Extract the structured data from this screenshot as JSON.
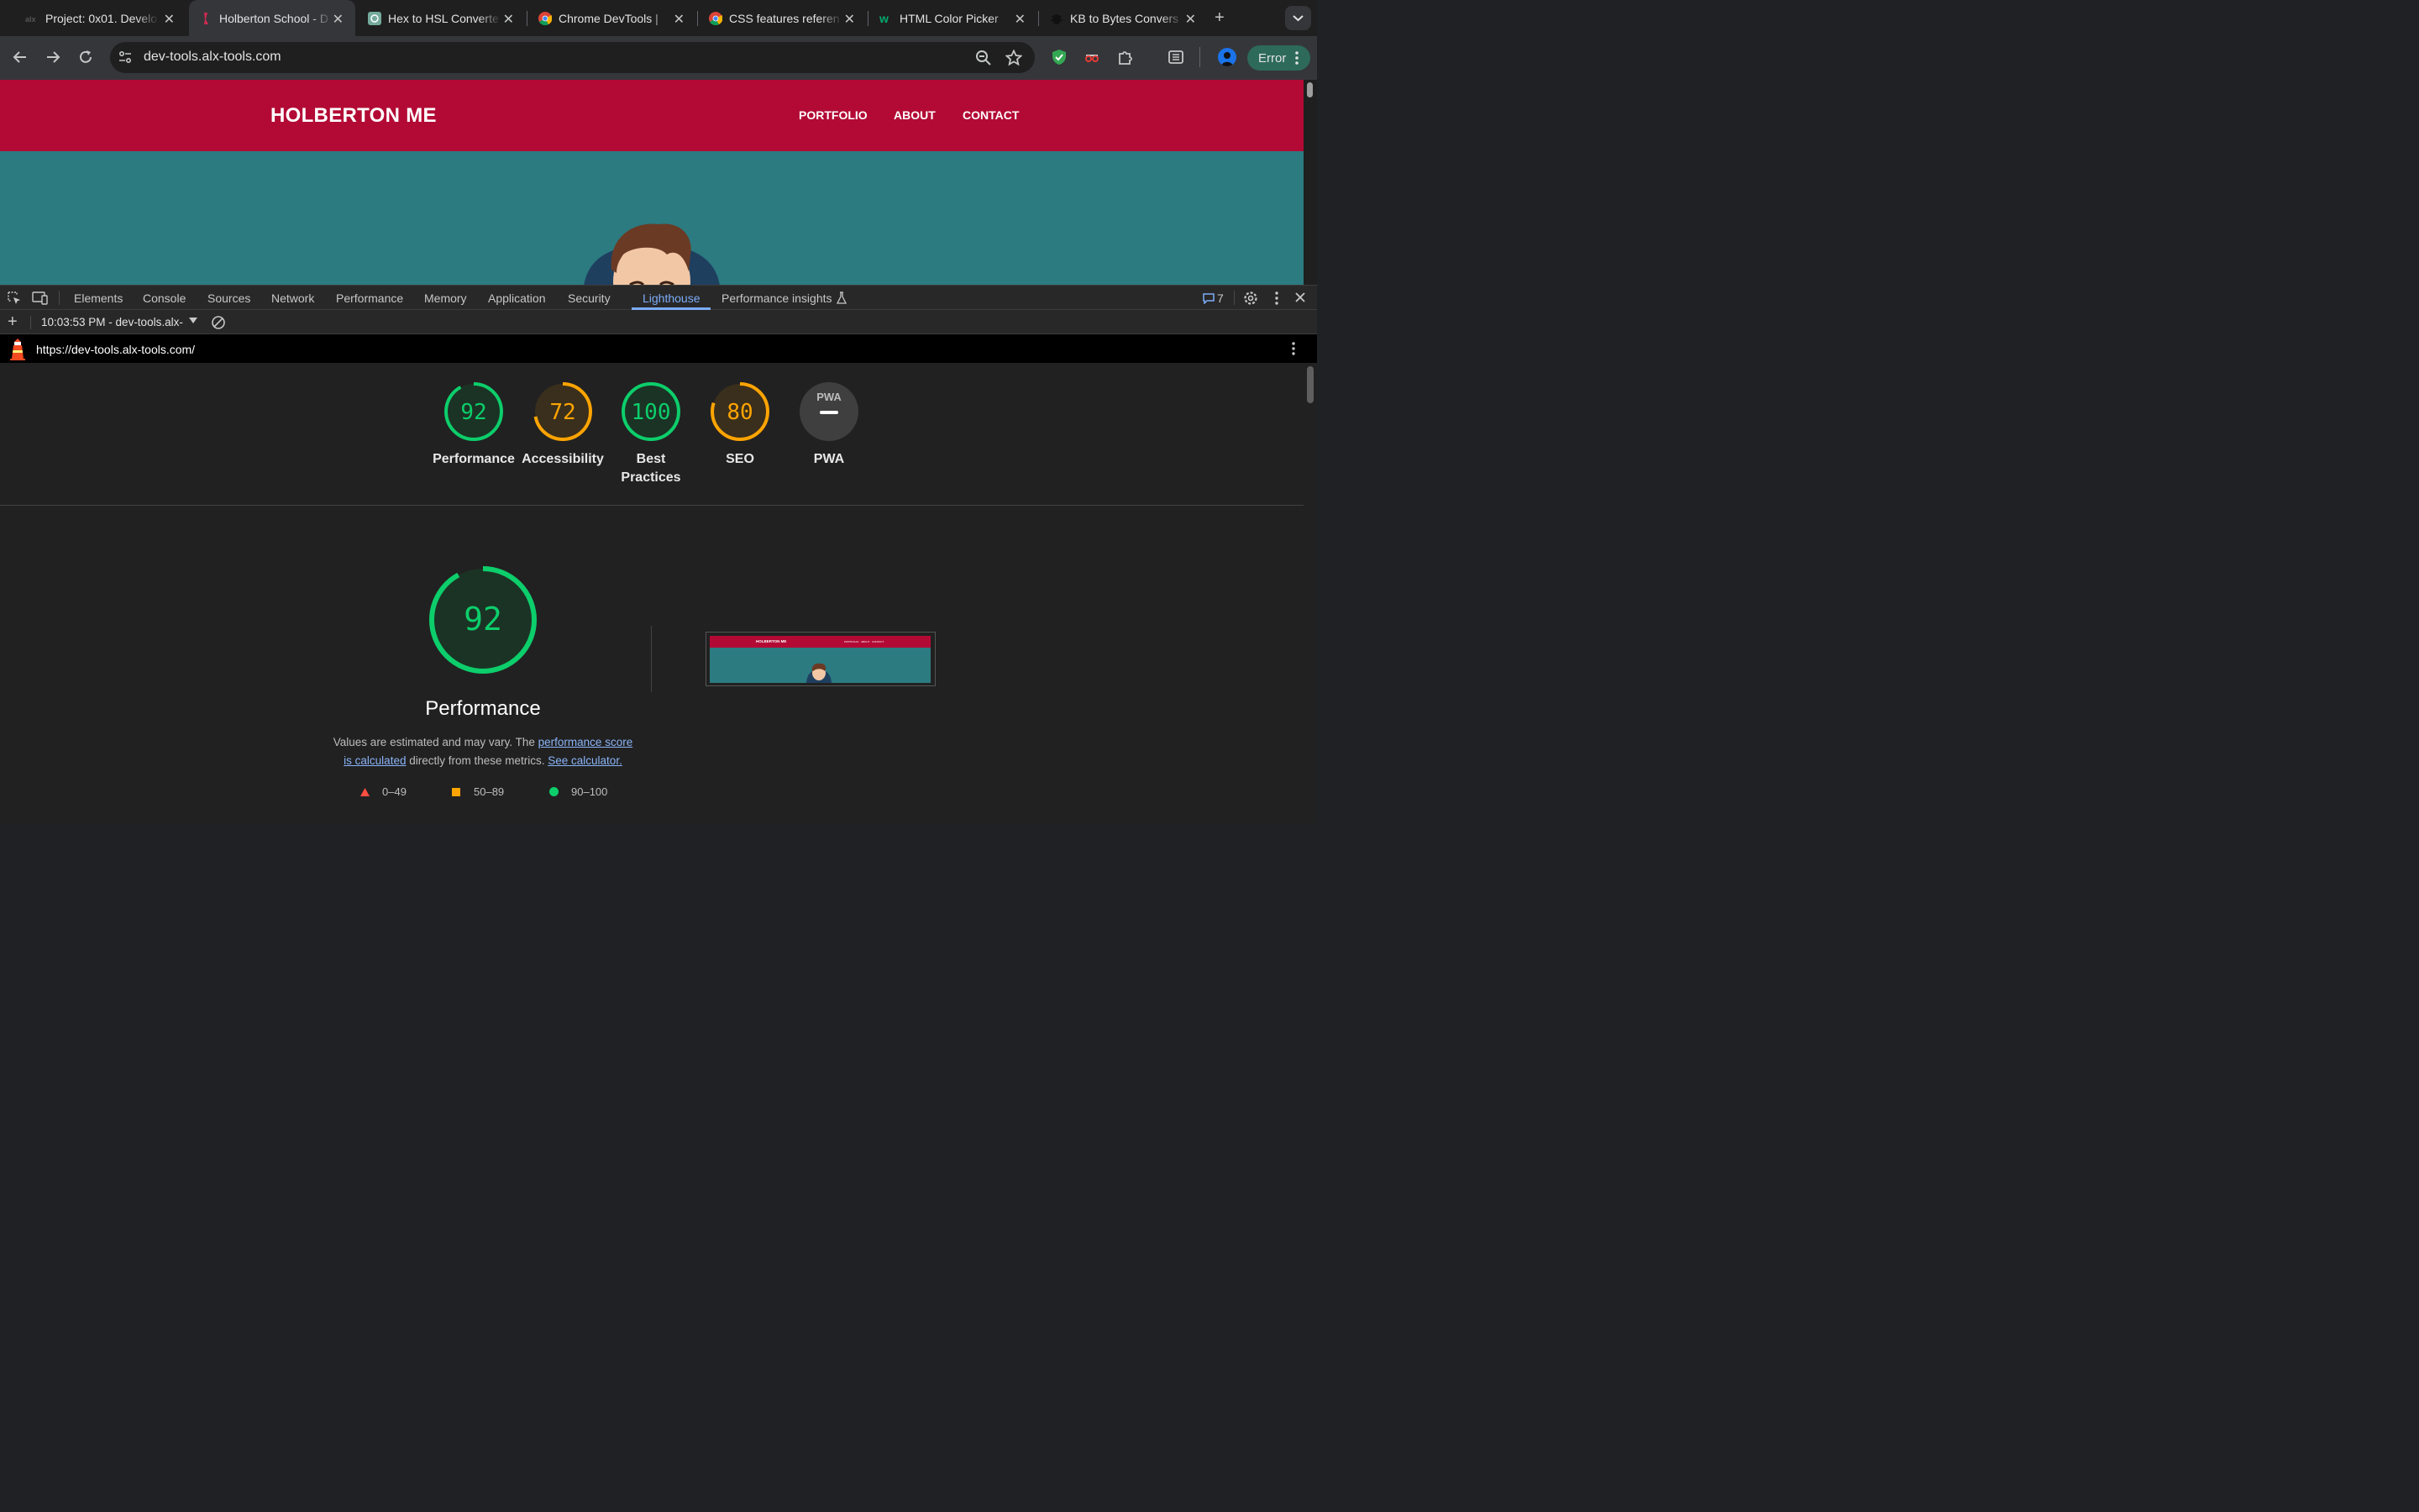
{
  "browser": {
    "tabs": [
      {
        "title": "Project: 0x01. Develo",
        "favicon": "alx-icon",
        "active": false
      },
      {
        "title": "Holberton School - D",
        "favicon": "holberton-icon",
        "active": true
      },
      {
        "title": "Hex to HSL Converte",
        "favicon": "chatgpt-icon",
        "active": false
      },
      {
        "title": "Chrome DevTools |",
        "favicon": "chrome-icon",
        "active": false
      },
      {
        "title": "CSS features referen",
        "favicon": "chrome-icon",
        "active": false
      },
      {
        "title": "HTML Color Picker",
        "favicon": "w3schools-icon",
        "active": false
      },
      {
        "title": "KB to Bytes Convers",
        "favicon": "bug-icon",
        "active": false
      }
    ],
    "url": "dev-tools.alx-tools.com",
    "profile_status": "Error"
  },
  "page": {
    "brand": "HOLBERTON ME",
    "nav": [
      "PORTFOLIO",
      "ABOUT",
      "CONTACT"
    ],
    "colors": {
      "header": "#b30a35",
      "hero": "#2b7b81"
    }
  },
  "devtools": {
    "tabs": [
      "Elements",
      "Console",
      "Sources",
      "Network",
      "Performance",
      "Memory",
      "Application",
      "Security",
      "Lighthouse",
      "Performance insights"
    ],
    "active_tab": "Lighthouse",
    "issues_count": "7",
    "report_select": "10:03:53 PM - dev-tools.alx-",
    "report_url": "https://dev-tools.alx-tools.com/"
  },
  "lighthouse": {
    "categories": [
      {
        "label": "Performance",
        "score": "92",
        "color": "#0cce6b",
        "fraction": 0.92
      },
      {
        "label": "Accessibility",
        "score": "72",
        "color": "#ffa400",
        "fraction": 0.72
      },
      {
        "label": "Best Practices",
        "score": "100",
        "color": "#0cce6b",
        "fraction": 1.0
      },
      {
        "label": "SEO",
        "score": "80",
        "color": "#ffa400",
        "fraction": 0.8
      },
      {
        "label": "PWA",
        "score": "PWA",
        "color": "#9e9e9e",
        "fraction": 0
      }
    ],
    "main": {
      "score": "92",
      "fraction": 0.92,
      "title": "Performance",
      "desc_prefix": "Values are estimated and may vary. The ",
      "desc_link1": "performance score is calculated",
      "desc_mid": " directly from these metrics. ",
      "desc_link2": "See calculator."
    },
    "thumbnail": {
      "brand": "HOLBERTON ME",
      "nav": [
        "PORTFOLIO",
        "ABOUT",
        "CONTACT"
      ]
    },
    "legend": [
      {
        "range": "0–49",
        "color": "#ff4e42",
        "shape": "triangle"
      },
      {
        "range": "50–89",
        "color": "#ffa400",
        "shape": "square"
      },
      {
        "range": "90–100",
        "color": "#0cce6b",
        "shape": "circle"
      }
    ]
  }
}
